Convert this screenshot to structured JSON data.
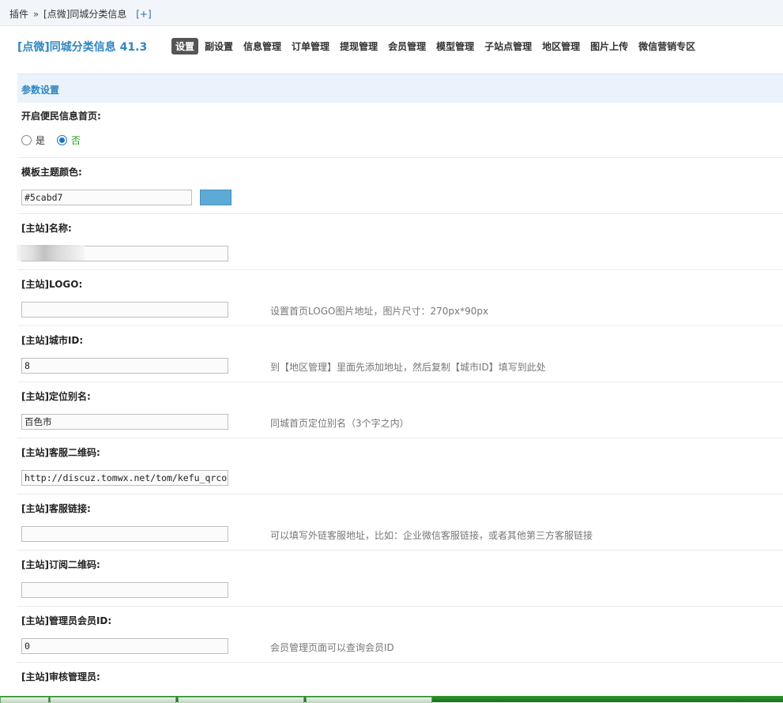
{
  "breadcrumb": {
    "root": "插件",
    "separator": "»",
    "current": "[点微]同城分类信息",
    "add": "[+]"
  },
  "plugin_title": "[点微]同城分类信息 41.3",
  "nav": [
    {
      "label": "设置",
      "active": true
    },
    {
      "label": "副设置"
    },
    {
      "label": "信息管理"
    },
    {
      "label": "订单管理"
    },
    {
      "label": "提现管理"
    },
    {
      "label": "会员管理"
    },
    {
      "label": "模型管理"
    },
    {
      "label": "子站点管理"
    },
    {
      "label": "地区管理"
    },
    {
      "label": "图片上传"
    },
    {
      "label": "微信营销专区"
    }
  ],
  "section_title": "参数设置",
  "fields": {
    "open_home": {
      "label": "开启便民信息首页:",
      "options": [
        "是",
        "否"
      ],
      "selected": "否"
    },
    "theme_color": {
      "label": "模板主题颜色:",
      "value": "#5cabd7",
      "swatch": "#5cabd7"
    },
    "site_name": {
      "label": "[主站]名称:",
      "value": ""
    },
    "logo": {
      "label": "[主站]LOGO:",
      "value": "",
      "hint": "设置首页LOGO图片地址，图片尺寸：270px*90px"
    },
    "city_id": {
      "label": "[主站]城市ID:",
      "value": "8",
      "hint": "到【地区管理】里面先添加地址，然后复制【城市ID】填写到此处"
    },
    "location_alias": {
      "label": "[主站]定位别名:",
      "value": "百色市",
      "hint": "同城首页定位别名（3个字之内）"
    },
    "service_qrcode": {
      "label": "[主站]客服二维码:",
      "value": "http://discuz.tomwx.net/tom/kefu_qrcode"
    },
    "service_link": {
      "label": "[主站]客服链接:",
      "value": "",
      "hint": "可以填写外链客服地址，比如：企业微信客服链接，或者其他第三方客服链接"
    },
    "subscribe_qrcode": {
      "label": "[主站]订阅二维码:",
      "value": ""
    },
    "admin_uid": {
      "label": "[主站]管理员会员ID:",
      "value": "0",
      "hint": "会员管理页面可以查询会员ID"
    },
    "reviewer": {
      "label": "[主站]审核管理员:"
    }
  },
  "colors": {
    "accent": "#2e86c1",
    "active_tab_bg": "#555555",
    "section_bg": "#eaf3fb",
    "taskbar": "#1a6e1a"
  }
}
